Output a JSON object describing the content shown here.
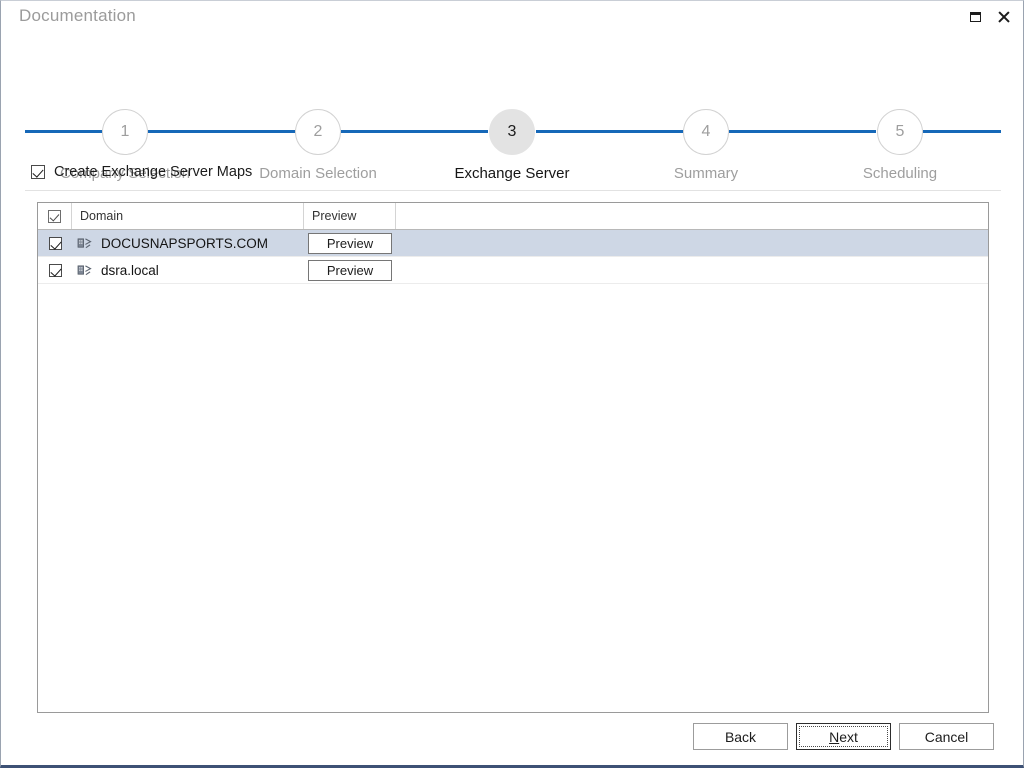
{
  "window": {
    "title": "Documentation",
    "controls": [
      {
        "name": "maximize",
        "label": "Maximize"
      },
      {
        "name": "close",
        "label": "Close"
      }
    ]
  },
  "stepper": {
    "current": 3,
    "steps": [
      {
        "number": "1",
        "label": "Company Selection"
      },
      {
        "number": "2",
        "label": "Domain Selection"
      },
      {
        "number": "3",
        "label": "Exchange Server"
      },
      {
        "number": "4",
        "label": "Summary"
      },
      {
        "number": "5",
        "label": "Scheduling"
      }
    ]
  },
  "options": {
    "create_maps": {
      "label": "Create Exchange Server Maps",
      "checked": true
    }
  },
  "grid": {
    "columns": [
      {
        "key": "check",
        "label": ""
      },
      {
        "key": "domain",
        "label": "Domain"
      },
      {
        "key": "preview",
        "label": "Preview"
      },
      {
        "key": "rest",
        "label": ""
      }
    ],
    "select_all_checked": true,
    "rows": [
      {
        "checked": true,
        "domain": "DOCUSNAPSPORTS.COM",
        "preview_label": "Preview",
        "selected": true
      },
      {
        "checked": true,
        "domain": "dsra.local",
        "preview_label": "Preview",
        "selected": false
      }
    ]
  },
  "footer": {
    "back_label": "Back",
    "next_label_pre": "",
    "next_accel": "N",
    "next_label_post": "ext",
    "cancel_label": "Cancel"
  },
  "colors": {
    "accent_line": "#1668b8",
    "selected_row": "#ced7e5",
    "active_step_fill": "#e3e3e3",
    "muted_text": "#9e9e9e",
    "window_bottom": "#3d5175"
  }
}
